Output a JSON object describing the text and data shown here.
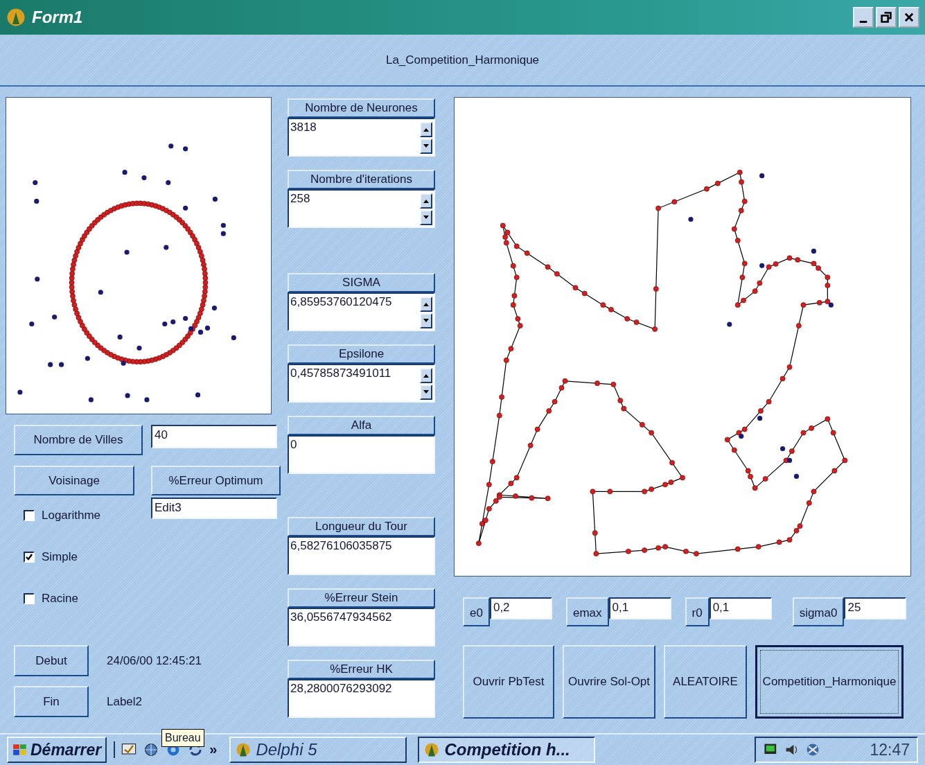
{
  "window": {
    "title": "Form1"
  },
  "header": {
    "title": "La_Competition_Harmonique"
  },
  "left_panel": {
    "villes_button": "Nombre de Villes",
    "villes_value": "40",
    "voisinage_button": "Voisinage",
    "erreur_optimum_button": "%Erreur Optimum",
    "erreur_optimum_value": "Edit3",
    "checkboxes": [
      {
        "label": "Logarithme",
        "checked": false
      },
      {
        "label": "Simple",
        "checked": true
      },
      {
        "label": "Racine",
        "checked": false
      }
    ],
    "debut_button": "Debut",
    "debut_time": "24/06/00 12:45:21",
    "fin_button": "Fin",
    "fin_label": "Label2"
  },
  "fields": [
    {
      "label": "Nombre de Neurones",
      "value": "3818",
      "kind": "spin"
    },
    {
      "label": "Nombre d'iterations",
      "value": "258",
      "kind": "spin"
    },
    {
      "label": "SIGMA",
      "value": "6,85953760120475",
      "kind": "spin"
    },
    {
      "label": "Epsilone",
      "value": "0,45785873491011",
      "kind": "spin"
    },
    {
      "label": "Alfa",
      "value": "0",
      "kind": "plain"
    },
    {
      "label": "Longueur du Tour",
      "value": "6,58276106035875",
      "kind": "plain"
    },
    {
      "label": "%Erreur Stein",
      "value": "36,0556747934562",
      "kind": "plain"
    },
    {
      "label": "%Erreur HK",
      "value": "28,2800076293092",
      "kind": "plain"
    }
  ],
  "params": [
    {
      "label": "e0",
      "value": "0,2"
    },
    {
      "label": "emax",
      "value": "0,1"
    },
    {
      "label": "r0",
      "value": "0,1"
    },
    {
      "label": "sigma0",
      "value": "25"
    }
  ],
  "actions": [
    {
      "label": "Ouvrir PbTest",
      "focused": false
    },
    {
      "label": "Ouvrire Sol-Opt",
      "focused": false
    },
    {
      "label": "ALEATOIRE",
      "focused": false
    },
    {
      "label": "Competition_Harmonique",
      "focused": true
    }
  ],
  "taskbar": {
    "start": "Démarrer",
    "chevron": "»",
    "tooltip": "Bureau",
    "tasks": [
      {
        "label": "Delphi 5",
        "selected": false
      },
      {
        "label": "Competition h...",
        "selected": true
      }
    ],
    "clock": "12:47"
  }
}
